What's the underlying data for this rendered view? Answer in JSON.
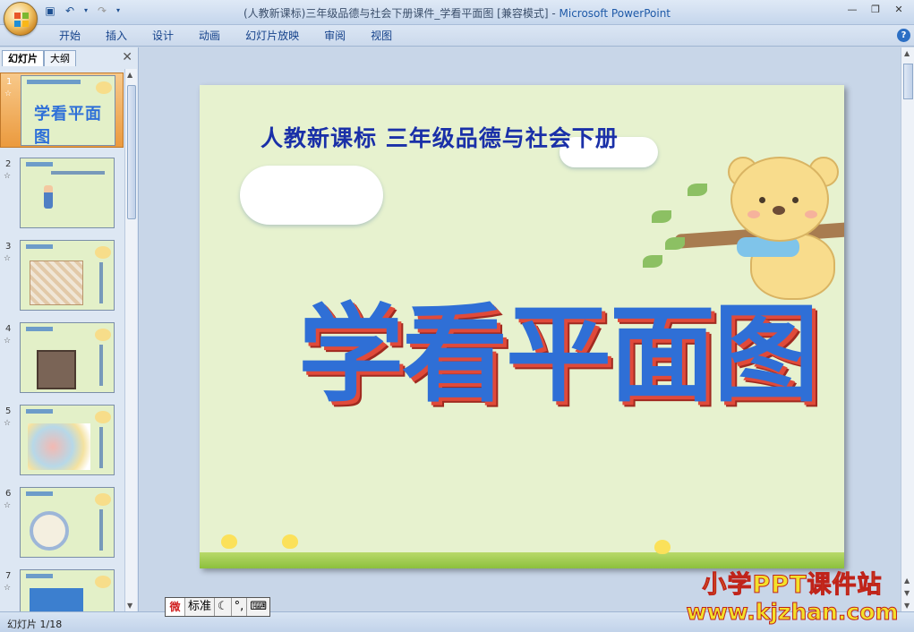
{
  "window": {
    "title": "(人教新课标)三年级品德与社会下册课件_学看平面图 [兼容模式]",
    "app_name": "Microsoft PowerPoint",
    "title_separator": " - "
  },
  "ribbon": {
    "tabs": [
      "开始",
      "插入",
      "设计",
      "动画",
      "幻灯片放映",
      "审阅",
      "视图"
    ],
    "help_label": "?"
  },
  "left_pane": {
    "tabs": [
      "幻灯片",
      "大纲"
    ],
    "close_glyph": "✕",
    "thumbnails": [
      {
        "num": "1",
        "text": "学看平面图"
      },
      {
        "num": "2",
        "text": ""
      },
      {
        "num": "3",
        "text": ""
      },
      {
        "num": "4",
        "text": ""
      },
      {
        "num": "5",
        "text": ""
      },
      {
        "num": "6",
        "text": ""
      },
      {
        "num": "7",
        "text": ""
      }
    ]
  },
  "slide": {
    "subtitle": "人教新课标 三年级品德与社会下册",
    "title": "学看平面图"
  },
  "status": {
    "slide_info": "幻灯片 1/18"
  },
  "ime": {
    "logo": "微",
    "mode": "标准",
    "moon": "☾",
    "punct": "°,",
    "keyboard": "⌨"
  },
  "watermark": {
    "line1": "小学PPT课件站",
    "line2": "www.kjzhan.com"
  },
  "colors": {
    "slide_bg": "#e7f2cf",
    "title_blue": "#2f6fd6",
    "title_shadow": "#e04a3a",
    "subtitle": "#1a30a8",
    "selected_thumb": "#eb9a3e"
  }
}
